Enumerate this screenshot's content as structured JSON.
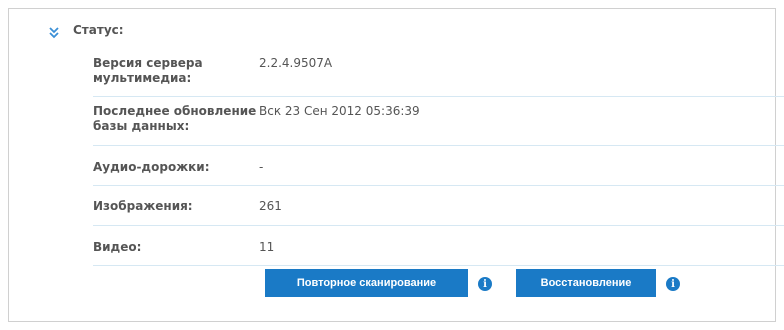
{
  "section": {
    "title": "Статус:",
    "icon": "chevron-double-down-icon"
  },
  "rows": [
    {
      "label": "Версия сервера мультимедиа:",
      "value": "2.2.4.9507A"
    },
    {
      "label": "Последнее обновление базы данных:",
      "value": "Вск 23 Сен 2012 05:36:39"
    },
    {
      "label": "Аудио-дорожки:",
      "value": "-"
    },
    {
      "label": "Изображения:",
      "value": "261"
    },
    {
      "label": "Видео:",
      "value": "11"
    }
  ],
  "buttons": {
    "rescan_label": "Повторное сканирование",
    "restore_label": "Восстановление",
    "info_icon": "info-icon",
    "info_glyph": "i"
  },
  "colors": {
    "accent": "#1a7ac6",
    "row_divider": "#d6e8f3",
    "text": "#555555",
    "panel_border": "#d0d0d0"
  }
}
